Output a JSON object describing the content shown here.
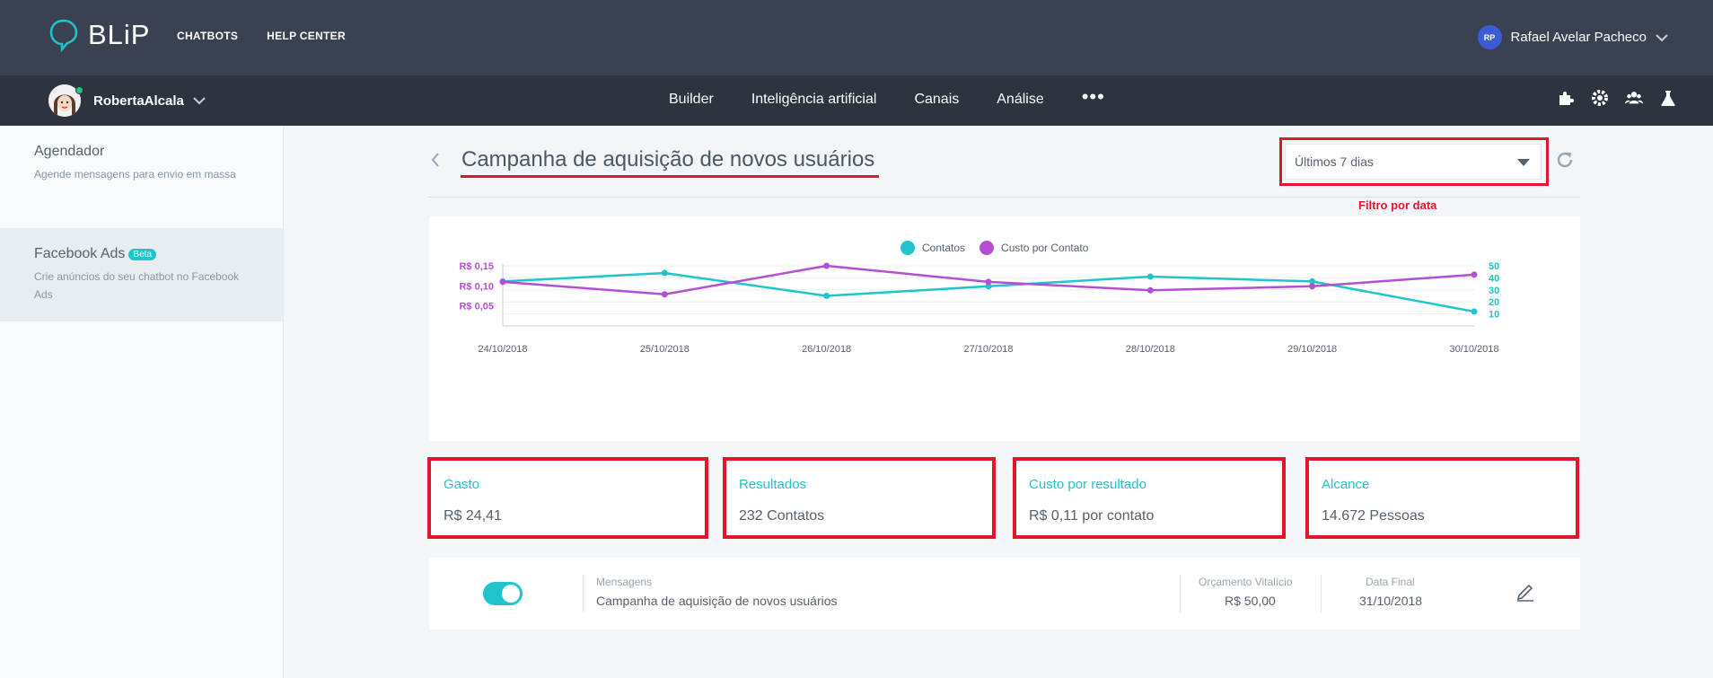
{
  "brand": {
    "logo_text": "BLiP"
  },
  "topnav": {
    "chatbots": "CHATBOTS",
    "help_center": "HELP CENTER"
  },
  "user": {
    "initials": "RP",
    "name": "Rafael Avelar Pacheco"
  },
  "bot": {
    "name": "RobertaAlcala"
  },
  "subnav": {
    "builder": "Builder",
    "ai": "Inteligência artificial",
    "channels": "Canais",
    "analysis": "Análise",
    "more": "•••"
  },
  "sidebar": {
    "items": [
      {
        "title": "Agendador",
        "desc": "Agende mensagens para envio em massa"
      },
      {
        "title": "Facebook Ads",
        "badge": "Beta",
        "desc": "Crie anúncios do seu chatbot no Facebook Ads"
      }
    ]
  },
  "page": {
    "title": "Campanha de aquisição de novos usuários"
  },
  "date_filter": {
    "selected": "Últimos 7 dias",
    "annotation": "Filtro por data"
  },
  "colors": {
    "teal": "#20c4cb",
    "purple": "#b44fd4",
    "red": "#e0162b"
  },
  "chart_data": {
    "type": "line",
    "categories": [
      "24/10/2018",
      "25/10/2018",
      "26/10/2018",
      "27/10/2018",
      "28/10/2018",
      "29/10/2018",
      "30/10/2018"
    ],
    "series": [
      {
        "name": "Contatos",
        "axis": "right",
        "color": "#20c4cb",
        "values": [
          37,
          44,
          25,
          33,
          41,
          37,
          12
        ]
      },
      {
        "name": "Custo por Contato",
        "axis": "left",
        "color": "#b44fd4",
        "values": [
          0.11,
          0.079,
          0.15,
          0.11,
          0.089,
          0.099,
          0.128
        ]
      }
    ],
    "left_axis": {
      "ticks": [
        "R$ 0,15",
        "R$ 0,10",
        "R$ 0,05"
      ],
      "tick_values": [
        0.15,
        0.1,
        0.05
      ],
      "ylim": [
        0,
        0.15
      ]
    },
    "right_axis": {
      "ticks": [
        "50",
        "40",
        "30",
        "20",
        "10"
      ],
      "tick_values": [
        50,
        40,
        30,
        20,
        10
      ],
      "ylim": [
        0,
        50
      ]
    },
    "legend": "top-center",
    "grid": true
  },
  "kpis": [
    {
      "label": "Gasto",
      "value": "R$ 24,41"
    },
    {
      "label": "Resultados",
      "value": "232 Contatos"
    },
    {
      "label": "Custo por resultado",
      "value": "R$ 0,11 por contato"
    },
    {
      "label": "Alcance",
      "value": "14.672 Pessoas"
    }
  ],
  "campaign": {
    "messages_label": "Mensagens",
    "messages_value": "Campanha de aquisição de novos usuários",
    "budget_label": "Orçamento Vitalício",
    "budget_value": "R$ 50,00",
    "end_label": "Data Final",
    "end_value": "31/10/2018",
    "active": true
  }
}
